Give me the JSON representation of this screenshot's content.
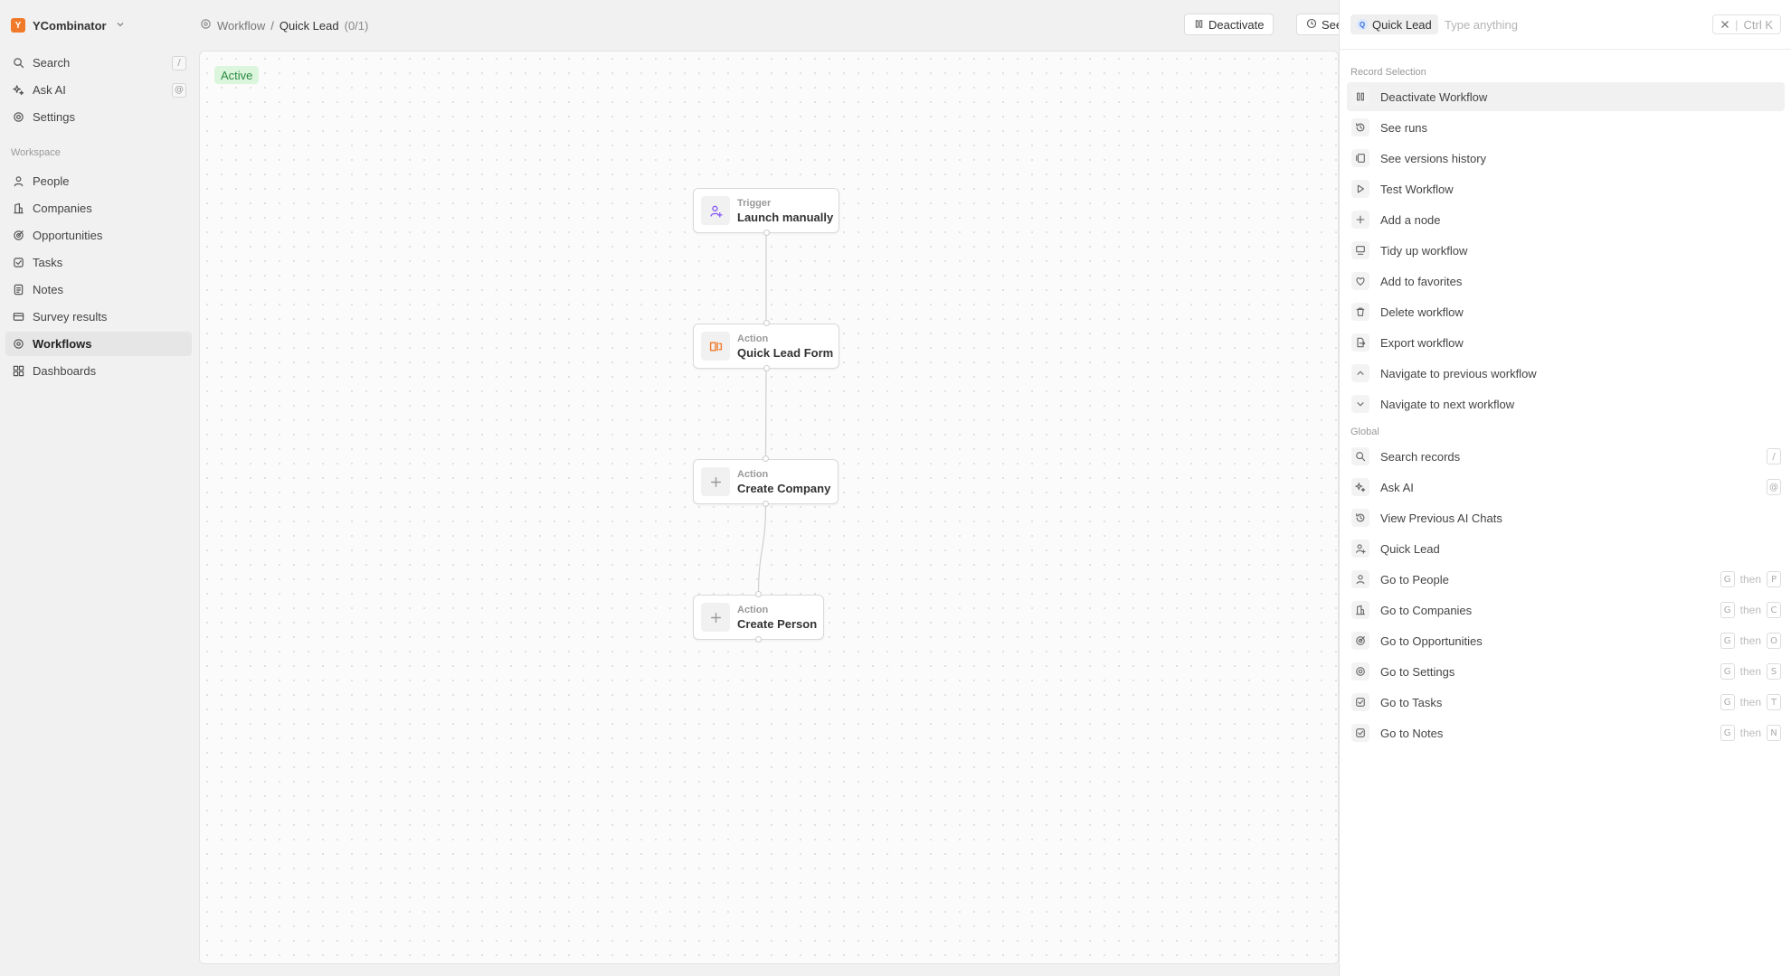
{
  "workspace": {
    "logo_letter": "Y",
    "name": "YCombinator"
  },
  "sidebar": {
    "top_items": [
      {
        "label": "Search",
        "icon": "search-icon",
        "kbd": "/"
      },
      {
        "label": "Ask AI",
        "icon": "sparkle-icon",
        "kbd": "@"
      },
      {
        "label": "Settings",
        "icon": "gear-icon"
      }
    ],
    "section_label": "Workspace",
    "items": [
      {
        "label": "People",
        "icon": "person-icon"
      },
      {
        "label": "Companies",
        "icon": "building-icon"
      },
      {
        "label": "Opportunities",
        "icon": "target-icon"
      },
      {
        "label": "Tasks",
        "icon": "checkbox-icon"
      },
      {
        "label": "Notes",
        "icon": "note-icon"
      },
      {
        "label": "Survey results",
        "icon": "survey-icon"
      },
      {
        "label": "Workflows",
        "icon": "workflow-icon",
        "active": true
      },
      {
        "label": "Dashboards",
        "icon": "dashboard-icon"
      }
    ]
  },
  "breadcrumb": {
    "root": "Workflow",
    "separator": "/",
    "current": "Quick Lead",
    "count": "(0/1)"
  },
  "toolbar": {
    "deactivate_label": "Deactivate",
    "see_label": "See"
  },
  "canvas": {
    "status": "Active",
    "nodes": [
      {
        "type": "Trigger",
        "title": "Launch manually",
        "icon": "person-plus-icon"
      },
      {
        "type": "Action",
        "title": "Quick Lead Form",
        "icon": "form-icon"
      },
      {
        "type": "Action",
        "title": "Create Company",
        "icon": "plus-icon"
      },
      {
        "type": "Action",
        "title": "Create Person",
        "icon": "plus-icon"
      }
    ]
  },
  "panel": {
    "chip_label": "Quick Lead",
    "chip_letter": "Q",
    "search_placeholder": "Type anything",
    "close_label": "Ctrl K",
    "record_section": "Record Selection",
    "record_commands": [
      {
        "label": "Deactivate Workflow",
        "icon": "pause-icon",
        "highlighted": true
      },
      {
        "label": "See runs",
        "icon": "history-icon"
      },
      {
        "label": "See versions history",
        "icon": "versions-icon"
      },
      {
        "label": "Test Workflow",
        "icon": "play-icon"
      },
      {
        "label": "Add a node",
        "icon": "plus-icon"
      },
      {
        "label": "Tidy up workflow",
        "icon": "tidy-icon"
      },
      {
        "label": "Add to favorites",
        "icon": "heart-icon"
      },
      {
        "label": "Delete workflow",
        "icon": "trash-icon"
      },
      {
        "label": "Export workflow",
        "icon": "export-icon"
      },
      {
        "label": "Navigate to previous workflow",
        "icon": "chevron-up-icon"
      },
      {
        "label": "Navigate to next workflow",
        "icon": "chevron-down-icon"
      }
    ],
    "global_section": "Global",
    "global_commands": [
      {
        "label": "Search records",
        "icon": "search-icon",
        "keys": [
          "/"
        ]
      },
      {
        "label": "Ask AI",
        "icon": "sparkle-icon",
        "keys": [
          "@"
        ]
      },
      {
        "label": "View Previous AI Chats",
        "icon": "history-icon"
      },
      {
        "label": "Quick Lead",
        "icon": "person-plus-icon"
      },
      {
        "label": "Go to People",
        "icon": "person-icon",
        "keys": [
          "G",
          "P"
        ]
      },
      {
        "label": "Go to Companies",
        "icon": "building-icon",
        "keys": [
          "G",
          "C"
        ]
      },
      {
        "label": "Go to Opportunities",
        "icon": "target-icon",
        "keys": [
          "G",
          "O"
        ]
      },
      {
        "label": "Go to Settings",
        "icon": "gear-icon",
        "keys": [
          "G",
          "S"
        ]
      },
      {
        "label": "Go to Tasks",
        "icon": "checkbox-icon",
        "keys": [
          "G",
          "T"
        ]
      },
      {
        "label": "Go to Notes",
        "icon": "checkbox-icon",
        "keys": [
          "G",
          "N"
        ]
      }
    ],
    "then_word": "then"
  },
  "colors": {
    "brand": "#f07a2a",
    "active_bg": "#dcf5dd",
    "active_text": "#2b8a3e",
    "trigger_icon": "#8a5cf6",
    "form_icon": "#f07a2a"
  }
}
